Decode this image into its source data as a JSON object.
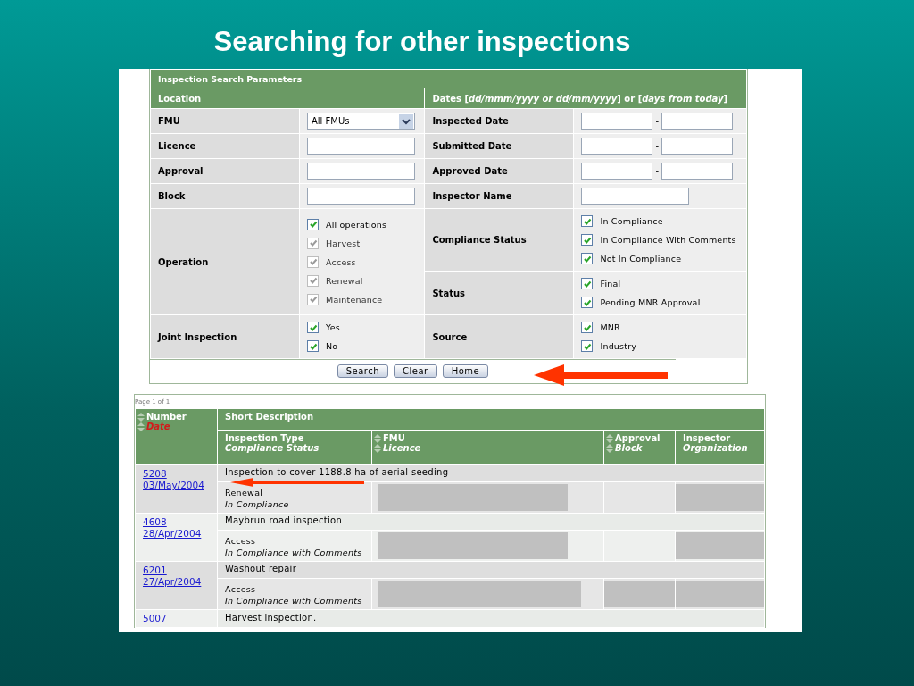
{
  "title": "Searching for other inspections",
  "search_form": {
    "heading": "Inspection Search Parameters",
    "location_heading": "Location",
    "dates_heading": "Dates [*dd/mmm/yyyy or dd/mm/yyyy*] or [*days from today*]",
    "left_fields": [
      {
        "label": "FMU",
        "kind": "select",
        "value": "All FMUs"
      },
      {
        "label": "Licence",
        "kind": "text"
      },
      {
        "label": "Approval",
        "kind": "text"
      },
      {
        "label": "Block",
        "kind": "text"
      },
      {
        "label": "Operation",
        "kind": "checklist",
        "options": [
          {
            "label": "All operations",
            "checked": true,
            "disabled": false
          },
          {
            "label": "Harvest",
            "checked": true,
            "disabled": true
          },
          {
            "label": "Access",
            "checked": true,
            "disabled": true
          },
          {
            "label": "Renewal",
            "checked": true,
            "disabled": true
          },
          {
            "label": "Maintenance",
            "checked": true,
            "disabled": true
          }
        ]
      },
      {
        "label": "Joint Inspection",
        "kind": "checklist",
        "options": [
          {
            "label": "Yes",
            "checked": true,
            "disabled": false
          },
          {
            "label": "No",
            "checked": true,
            "disabled": false
          }
        ]
      }
    ],
    "right_fields": [
      {
        "label": "Inspected Date",
        "kind": "date_range",
        "separator": "-"
      },
      {
        "label": "Submitted Date",
        "kind": "date_range",
        "separator": "-"
      },
      {
        "label": "Approved Date",
        "kind": "date_range",
        "separator": "-"
      },
      {
        "label": "Inspector Name",
        "kind": "text"
      },
      {
        "label": "Compliance Status",
        "kind": "checklist",
        "options": [
          {
            "label": "In Compliance",
            "checked": true,
            "disabled": false
          },
          {
            "label": "In Compliance With Comments",
            "checked": true,
            "disabled": false
          },
          {
            "label": "Not In Compliance",
            "checked": true,
            "disabled": false
          }
        ]
      },
      {
        "label": "Status",
        "kind": "checklist",
        "options": [
          {
            "label": "Final",
            "checked": true,
            "disabled": false
          },
          {
            "label": "Pending MNR Approval",
            "checked": true,
            "disabled": false
          }
        ]
      },
      {
        "label": "Source",
        "kind": "checklist",
        "options": [
          {
            "label": "MNR",
            "checked": true,
            "disabled": false
          },
          {
            "label": "Industry",
            "checked": true,
            "disabled": false
          }
        ]
      }
    ],
    "buttons": [
      "Search",
      "Clear",
      "Home"
    ]
  },
  "results": {
    "page_info": "Page 1 of 1",
    "columns": {
      "number": "Number",
      "date": "Date",
      "short_description": "Short Description",
      "inspection_type": "Inspection Type",
      "compliance_status": "Compliance Status",
      "fmu": "FMU",
      "licence": "Licence",
      "approval": "Approval",
      "block": "Block",
      "inspector": "Inspector",
      "organization": "Organization"
    },
    "rows": [
      {
        "number": "5208",
        "date": "03/May/2004",
        "description": "Inspection to cover 1188.8 ha of aerial seeding",
        "inspection_type": "Renewal",
        "compliance_status": "In Compliance",
        "redacted": [
          true,
          false,
          true
        ]
      },
      {
        "number": "4608",
        "date": "28/Apr/2004",
        "description": "Maybrun road inspection",
        "inspection_type": "Access",
        "compliance_status": "In Compliance with Comments",
        "redacted": [
          true,
          false,
          true
        ]
      },
      {
        "number": "6201",
        "date": "27/Apr/2004",
        "description": "Washout repair",
        "inspection_type": "Access",
        "compliance_status": "In Compliance with Comments",
        "redacted": [
          true,
          true,
          true
        ]
      },
      {
        "number": "5007",
        "description": "Harvest inspection."
      }
    ]
  }
}
